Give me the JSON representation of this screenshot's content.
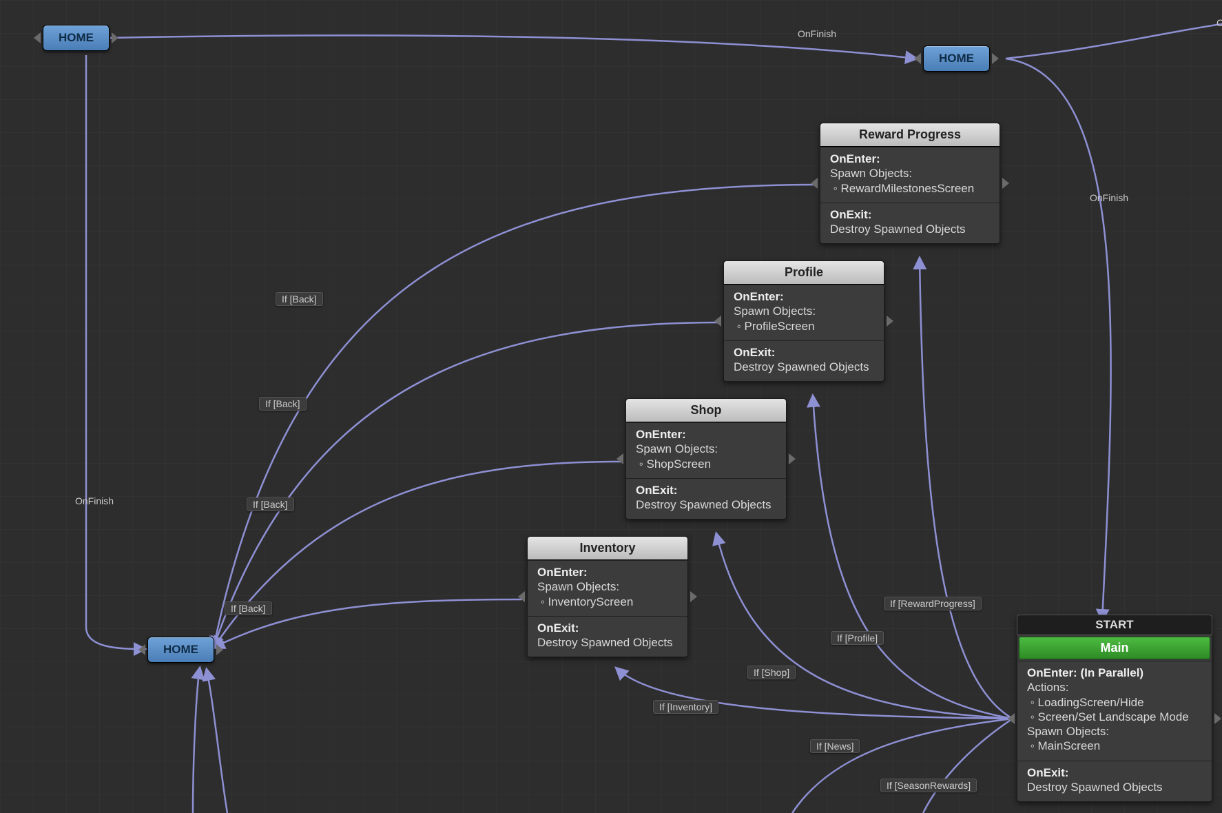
{
  "home_label": "HOME",
  "start_label": "START",
  "main_label": "Main",
  "nodes": {
    "reward": {
      "title": "Reward Progress",
      "onenter": "OnEnter:",
      "spawn": "Spawn Objects:",
      "item": "RewardMilestonesScreen",
      "onexit": "OnExit:",
      "destroy": "Destroy Spawned Objects"
    },
    "profile": {
      "title": "Profile",
      "onenter": "OnEnter:",
      "spawn": "Spawn Objects:",
      "item": "ProfileScreen",
      "onexit": "OnExit:",
      "destroy": "Destroy Spawned Objects"
    },
    "shop": {
      "title": "Shop",
      "onenter": "OnEnter:",
      "spawn": "Spawn Objects:",
      "item": "ShopScreen",
      "onexit": "OnExit:",
      "destroy": "Destroy Spawned Objects"
    },
    "inventory": {
      "title": "Inventory",
      "onenter": "OnEnter:",
      "spawn": "Spawn Objects:",
      "item": "InventoryScreen",
      "onexit": "OnExit:",
      "destroy": "Destroy Spawned Objects"
    },
    "main": {
      "onenter": "OnEnter: (In Parallel)",
      "actions": "Actions:",
      "a1": "LoadingScreen/Hide",
      "a2": "Screen/Set Landscape Mode",
      "spawn": "Spawn Objects:",
      "item": "MainScreen",
      "onexit": "OnExit:",
      "destroy": "Destroy Spawned Objects"
    }
  },
  "edge_labels": {
    "onfinish_top": "OnFinish",
    "onfinish_left": "OnFinish",
    "onfinish_right": "OnFinish",
    "partial_right": "On",
    "back1": "If [Back]",
    "back2": "If [Back]",
    "back3": "If [Back]",
    "back4": "If [Back]",
    "rewardprogress": "If [RewardProgress]",
    "profile": "If [Profile]",
    "shop": "If [Shop]",
    "inventory": "If [Inventory]",
    "news": "If [News]",
    "seasonrewards": "If [SeasonRewards]"
  },
  "colors": {
    "edge": "#8e90d4"
  }
}
